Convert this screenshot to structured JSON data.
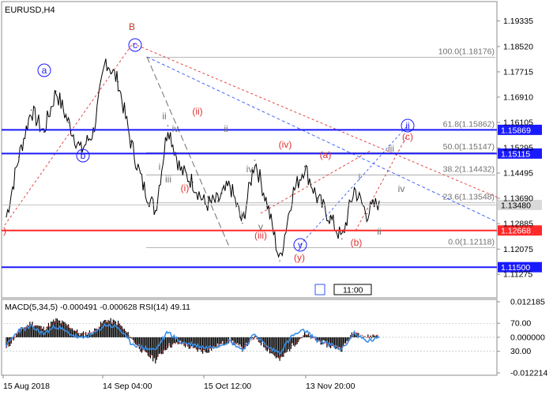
{
  "symbol": "EURUSD,H4",
  "chart_data": [
    {
      "type": "line",
      "name": "price",
      "ylim": [
        1.106,
        1.199
      ],
      "price_ticks": [
        "1.19335",
        "1.18520",
        "1.17715",
        "1.16910",
        "1.16105",
        "1.15295",
        "1.14495",
        "1.13690",
        "1.12885",
        "1.12075",
        "1.11275"
      ],
      "time_labels": [
        "15 Aug 2018",
        "14 Sep 04:00",
        "15 Oct 12:00",
        "13 Nov 20:00"
      ],
      "close": [
        1.131,
        1.15,
        1.165,
        1.158,
        1.171,
        1.161,
        1.152,
        1.158,
        1.181,
        1.174,
        1.155,
        1.141,
        1.133,
        1.16,
        1.146,
        1.142,
        1.135,
        1.136,
        1.141,
        1.129,
        1.149,
        1.135,
        1.117,
        1.138,
        1.147,
        1.137,
        1.131,
        1.124,
        1.14,
        1.132,
        1.136
      ],
      "fib_levels": [
        {
          "label": "100.0(1.18176)",
          "value": 1.18176
        },
        {
          "label": "61.8(1.15862)",
          "value": 1.15862
        },
        {
          "label": "50.0(1.15147)",
          "value": 1.15147
        },
        {
          "label": "38.2(1.14432)",
          "value": 1.14432
        },
        {
          "label": "23.6(1.13548)",
          "value": 1.13548
        },
        {
          "label": "0.0(1.12118)",
          "value": 1.12118
        }
      ],
      "horizontal_levels": [
        {
          "label": "1.15869",
          "value": 1.15869,
          "color": "#1a1aff"
        },
        {
          "label": "1.15115",
          "value": 1.15115,
          "color": "#1a1aff"
        },
        {
          "label": "1.13480",
          "value": 1.1348,
          "color": "#c0c0c0"
        },
        {
          "label": "1.12668",
          "value": 1.12668,
          "color": "#ff2a2a"
        },
        {
          "label": "1.11500",
          "value": 1.115,
          "color": "#1a1aff"
        }
      ],
      "wave_labels": [
        {
          "text": "B",
          "color": "#c0392b",
          "circled": false
        },
        {
          "text": "c",
          "color": "#1a1aff",
          "circled": true
        },
        {
          "text": "a",
          "color": "#1a1aff",
          "circled": true
        },
        {
          "text": "b",
          "color": "#1a1aff",
          "circled": true
        },
        {
          "text": "ii",
          "color": "#1a1aff",
          "circled": true
        },
        {
          "text": "y",
          "color": "#1a1aff",
          "circled": true
        },
        {
          "text": "(c)",
          "color": "#e03030",
          "circled": false
        },
        {
          "text": "(ii)",
          "color": "#e03030",
          "circled": false
        },
        {
          "text": "(iv)",
          "color": "#e03030",
          "circled": false
        },
        {
          "text": "(a)",
          "color": "#e03030",
          "circled": false
        },
        {
          "text": "(i)",
          "color": "#e03030",
          "circled": false
        },
        {
          "text": "(iii)",
          "color": "#e03030",
          "circled": false
        },
        {
          "text": "(y)",
          "color": "#e03030",
          "circled": false
        },
        {
          "text": "(b)",
          "color": "#e03030",
          "circled": false
        },
        {
          "text": ")",
          "color": "#e03030",
          "circled": false
        },
        {
          "text": "ii",
          "color": "#707070",
          "circled": false
        },
        {
          "text": "iv",
          "color": "#707070",
          "circled": false
        },
        {
          "text": "i",
          "color": "#707070",
          "circled": false
        },
        {
          "text": "iii",
          "color": "#707070",
          "circled": false
        },
        {
          "text": "ii",
          "color": "#707070",
          "circled": false
        },
        {
          "text": "i",
          "color": "#707070",
          "circled": false
        },
        {
          "text": "iv",
          "color": "#707070",
          "circled": false
        },
        {
          "text": "iii",
          "color": "#707070",
          "circled": false
        },
        {
          "text": "v",
          "color": "#707070",
          "circled": false
        },
        {
          "text": "i",
          "color": "#707070",
          "circled": false
        },
        {
          "text": "iii",
          "color": "#707070",
          "circled": false
        },
        {
          "text": "iv",
          "color": "#707070",
          "circled": false
        },
        {
          "text": "ii",
          "color": "#707070",
          "circled": false
        }
      ],
      "timeframe_box": "11:00"
    },
    {
      "type": "line",
      "name": "MACD(5,34,5) -0.000491 -0.000628 RSI(14) 49.11",
      "ticks": [
        "0.012185",
        "70.00",
        "0.000000",
        "30.00",
        "-0.012214"
      ],
      "macd_hist": [
        -0.004,
        0.002,
        0.005,
        0.003,
        0.006,
        0.004,
        0.001,
        0.002,
        0.006,
        0.005,
        0.0,
        -0.005,
        -0.008,
        -0.003,
        -0.002,
        -0.004,
        -0.005,
        -0.003,
        -0.001,
        -0.004,
        0.0,
        -0.004,
        -0.008,
        -0.003,
        0.001,
        -0.001,
        -0.003,
        -0.004,
        0.002,
        0.0,
        0.001
      ],
      "rsi": [
        38,
        60,
        65,
        55,
        66,
        56,
        48,
        55,
        68,
        64,
        42,
        35,
        32,
        58,
        43,
        40,
        35,
        38,
        45,
        32,
        55,
        36,
        28,
        52,
        60,
        46,
        40,
        33,
        56,
        44,
        49
      ]
    }
  ]
}
